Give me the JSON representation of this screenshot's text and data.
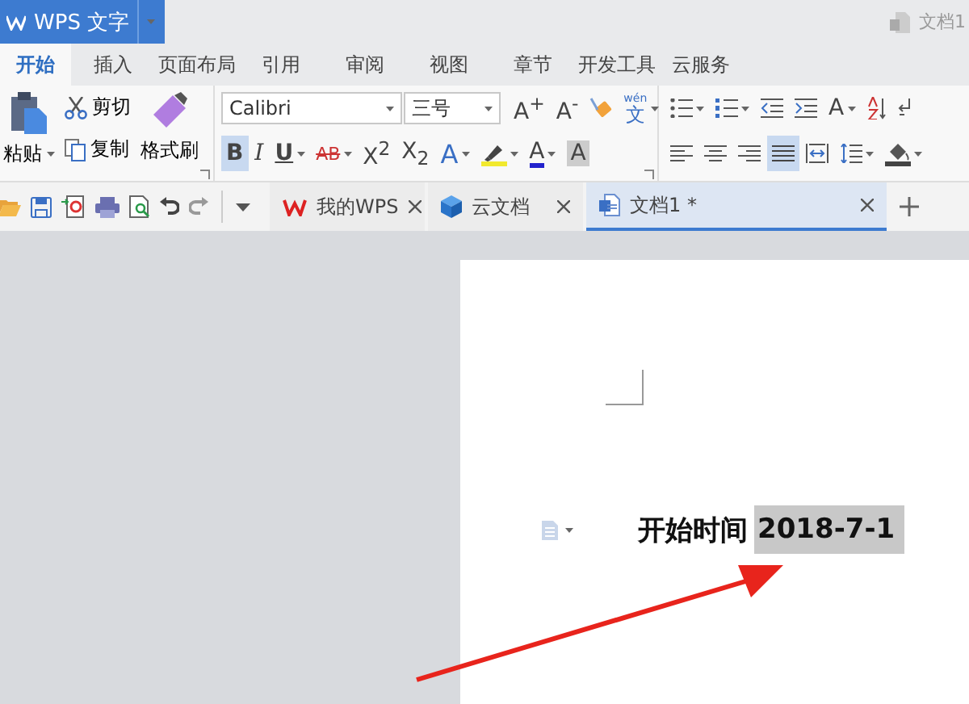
{
  "app_button": {
    "label": "WPS 文字"
  },
  "window_title": "文档1",
  "ribbon_tabs": [
    {
      "label": "开始",
      "selected": true
    },
    {
      "label": "插入",
      "selected": false
    },
    {
      "label": "页面布局",
      "selected": false
    },
    {
      "label": "引用",
      "selected": false
    },
    {
      "label": "审阅",
      "selected": false
    },
    {
      "label": "视图",
      "selected": false
    },
    {
      "label": "章节",
      "selected": false
    },
    {
      "label": "开发工具",
      "selected": false
    },
    {
      "label": "云服务",
      "selected": false
    }
  ],
  "clipboard": {
    "paste": "粘贴",
    "cut": "剪切",
    "copy": "复制",
    "format_painter": "格式刷"
  },
  "font": {
    "font_name": "Calibri",
    "font_size": "三号"
  },
  "font_row1_tools": [
    {
      "kind": "grow-font",
      "label": "A$^{+}$",
      "caret": false
    },
    {
      "kind": "shrink-font",
      "label": "A$^{-}$",
      "caret": false
    },
    {
      "kind": "clear-format",
      "caret": false
    },
    {
      "kind": "phonetic",
      "label": "文",
      "ruby": "wén",
      "caret": true
    }
  ],
  "font_row2_tools": [
    {
      "kind": "bold",
      "label": "B",
      "selected": true,
      "caret": false
    },
    {
      "kind": "italic",
      "label": "I",
      "selected": false,
      "caret": false
    },
    {
      "kind": "underline",
      "label": "U",
      "selected": false,
      "caret": true
    },
    {
      "kind": "strikethrough",
      "label": "AB",
      "selected": false,
      "caret": true
    },
    {
      "kind": "superscript",
      "label": "X$^{2}$",
      "selected": false,
      "caret": false
    },
    {
      "kind": "subscript",
      "label": "X$_{2}$",
      "selected": false,
      "caret": false
    },
    {
      "kind": "text-effect",
      "label": "A",
      "selected": false,
      "caret": true
    },
    {
      "kind": "highlight",
      "selected": false,
      "caret": true
    },
    {
      "kind": "font-color",
      "label": "A",
      "selected": false,
      "caret": true
    },
    {
      "kind": "char-shading",
      "label": "A",
      "selected": false,
      "caret": false
    }
  ],
  "para_row1_tools": [
    {
      "kind": "bullets",
      "caret": true
    },
    {
      "kind": "numbering",
      "caret": true
    },
    {
      "kind": "outdent",
      "caret": false
    },
    {
      "kind": "indent",
      "caret": false
    },
    {
      "kind": "text-size",
      "label": "A",
      "caret": true
    },
    {
      "kind": "sort",
      "caret": false
    },
    {
      "kind": "paragraph-mark",
      "caret": false
    }
  ],
  "para_row2_tools": [
    {
      "kind": "align-left",
      "selected": false,
      "caret": false
    },
    {
      "kind": "align-center",
      "selected": false,
      "caret": false
    },
    {
      "kind": "align-right",
      "selected": false,
      "caret": false
    },
    {
      "kind": "justify",
      "selected": true,
      "caret": false
    },
    {
      "kind": "distribute",
      "selected": false,
      "caret": false
    },
    {
      "kind": "line-spacing",
      "selected": false,
      "caret": true
    },
    {
      "kind": "shading",
      "selected": false,
      "caret": true
    }
  ],
  "quick_tools": [
    {
      "kind": "open"
    },
    {
      "kind": "save"
    },
    {
      "kind": "export-pdf"
    },
    {
      "kind": "print"
    },
    {
      "kind": "print-preview"
    },
    {
      "kind": "undo"
    },
    {
      "kind": "redo"
    },
    {
      "kind": "more"
    }
  ],
  "doc_tabs": [
    {
      "kind": "wps",
      "label": "我的WPS",
      "selected": false
    },
    {
      "kind": "cloud",
      "label": "云文档",
      "selected": false
    },
    {
      "kind": "doc",
      "label": "文档1 *",
      "selected": true
    }
  ],
  "document": {
    "label": "开始时间",
    "value": "2018-7-1",
    "value_selected": true
  }
}
